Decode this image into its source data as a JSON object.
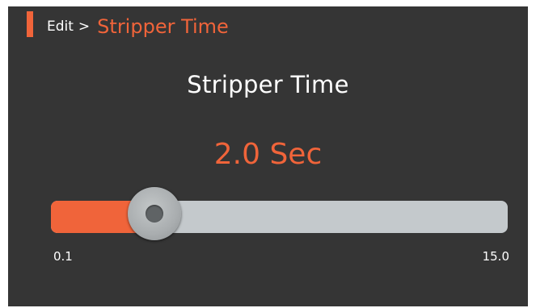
{
  "header": {
    "parent_label": "Edit",
    "separator": ">",
    "current_label": "Stripper Time"
  },
  "setting": {
    "title": "Stripper Time",
    "value_text": "2.0 Sec",
    "value": 2.0,
    "unit": "Sec"
  },
  "slider": {
    "min_label": "0.1",
    "max_label": "15.0",
    "min": 0.1,
    "max": 15.0,
    "value": 2.0
  },
  "colors": {
    "accent": "#f0643a",
    "background": "#353535",
    "track": "#c4c9cc",
    "text": "#ffffff"
  }
}
